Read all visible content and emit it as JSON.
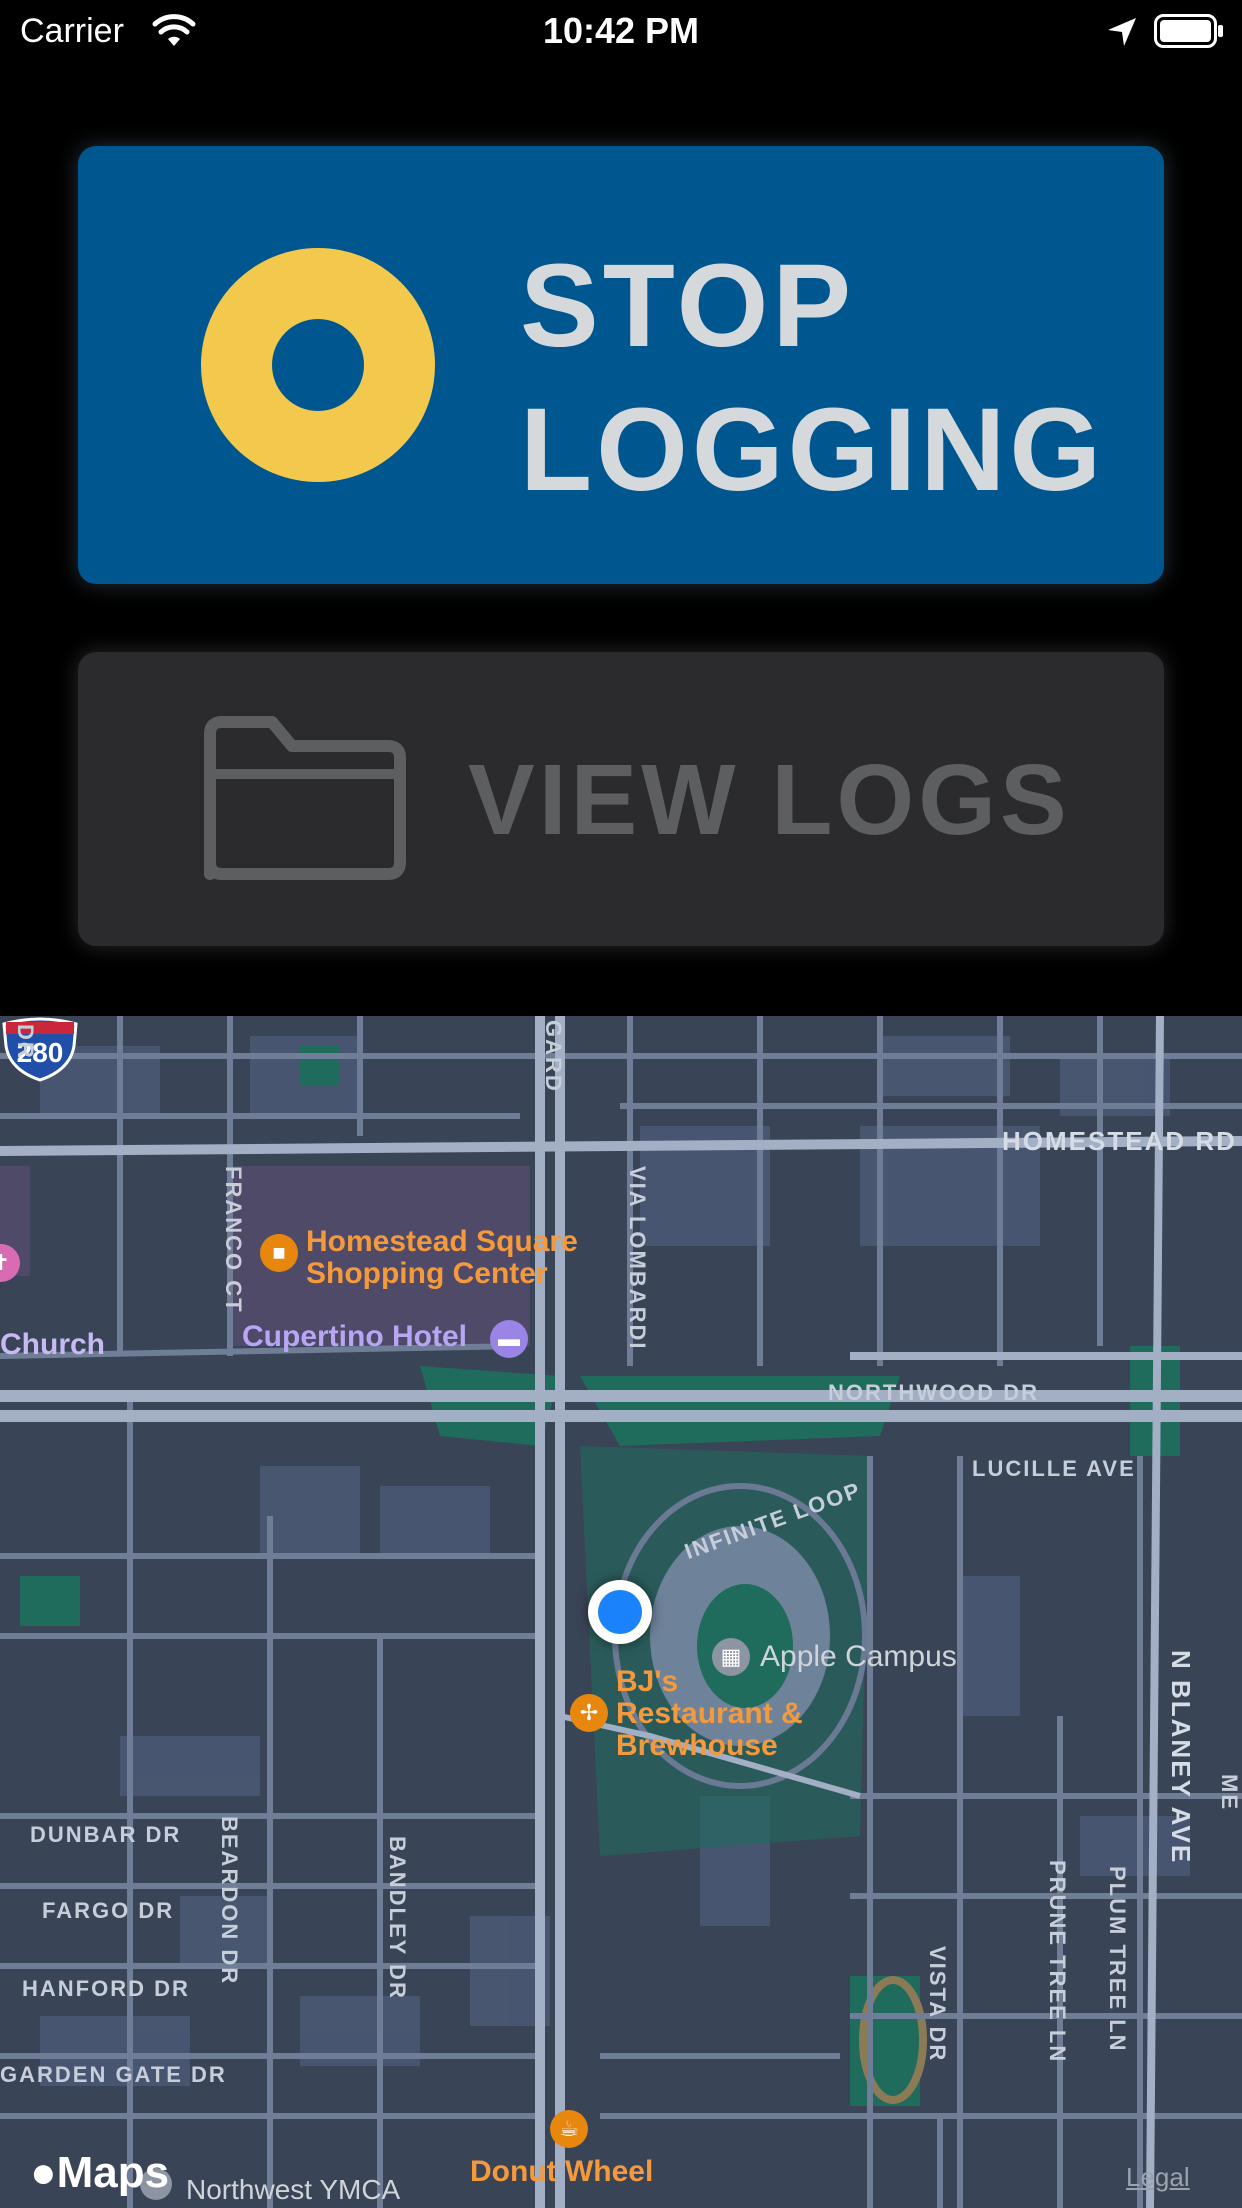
{
  "status_bar": {
    "carrier": "Carrier",
    "time": "10:42 PM",
    "icons": [
      "wifi-icon",
      "location-arrow-icon",
      "battery-icon"
    ]
  },
  "buttons": {
    "stop_logging": {
      "line1": "STOP",
      "line2": "LOGGING",
      "icon": "record-ring-icon",
      "color": "#005790",
      "icon_color": "#f2c94c"
    },
    "view_logs": {
      "label": "VIEW LOGS",
      "icon": "folder-icon",
      "color": "#2b2b2d"
    }
  },
  "map": {
    "streets": {
      "homestead_rd": "HOMESTEAD RD",
      "northwood_dr": "NORTHWOOD DR",
      "lucille_ave": "LUCILLE AVE",
      "infinite_loop": "INFINITE LOOP",
      "franco_ct": "FRANCO CT",
      "via_lombardi": "VIA LOMBARDI",
      "gard": "GARD",
      "dr_top_left": "DR",
      "dunbar_dr": "DUNBAR DR",
      "fargo_dr": "FARGO DR",
      "hanford_dr": "HANFORD DR",
      "garden_gate_dr": "GARDEN GATE DR",
      "beardon_dr": "BEARDON DR",
      "bandley_dr": "BANDLEY DR",
      "vista_dr": "VISTA DR",
      "prune_tree_ln": "PRUNE TREE LN",
      "plum_tree_ln": "PLUM TREE LN",
      "n_blaney_ave": "N BLANEY AVE",
      "me": "ME"
    },
    "highway_shield": "280",
    "pois": {
      "homestead_square": [
        "Homestead Square",
        "Shopping Center"
      ],
      "cupertino_hotel": "Cupertino Hotel",
      "church": "Church",
      "apple_campus": "Apple Campus",
      "bjs": [
        "BJ's",
        "Restaurant &",
        "Brewhouse"
      ],
      "donut_wheel": "Donut Wheel",
      "northwest_ymca": "Northwest YMCA"
    },
    "attribution": {
      "logo": "Maps",
      "legal": "Legal"
    },
    "colors": {
      "background": "#3a4457",
      "road": "#a3afc4",
      "park": "#1f6b5c",
      "user_dot": "#1a82fb"
    }
  }
}
